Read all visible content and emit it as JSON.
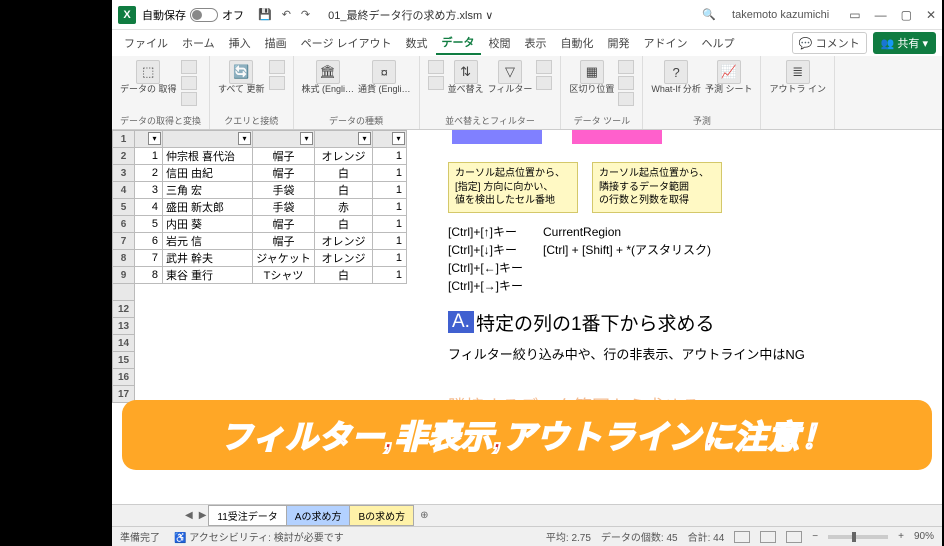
{
  "titlebar": {
    "autosave_label": "自動保存",
    "autosave_state": "オフ",
    "filename": "01_最終データ行の求め方.xlsm ∨",
    "search_icon": "🔍",
    "user": "takemoto kazumichi"
  },
  "menu": {
    "tabs": [
      "ファイル",
      "ホーム",
      "挿入",
      "描画",
      "ページ レイアウト",
      "数式",
      "データ",
      "校閲",
      "表示",
      "自動化",
      "開発",
      "アドイン",
      "ヘルプ"
    ],
    "active_index": 6,
    "comment": "コメント",
    "share": "共有"
  },
  "ribbon": {
    "g0": {
      "main": "データの\n取得",
      "label": "データの取得と変換"
    },
    "g1": {
      "main": "すべて\n更新",
      "label": "クエリと接続"
    },
    "g2": {
      "a": "株式 (Engli…",
      "b": "通貨 (Engli…",
      "label": "データの種類"
    },
    "g3": {
      "a": "並べ替え",
      "b": "フィルター",
      "label": "並べ替えとフィルター"
    },
    "g4": {
      "main": "区切り位置",
      "label": "データ ツール"
    },
    "g5": {
      "a": "What-If 分析",
      "b": "予測\nシート",
      "label": "予測"
    },
    "g6": {
      "main": "アウトラ\nイン"
    }
  },
  "table": {
    "rows": [
      {
        "n": "1",
        "name": "仲宗根 喜代治",
        "item": "帽子",
        "color": "オレンジ",
        "qty": "1"
      },
      {
        "n": "2",
        "name": "信田 由紀",
        "item": "帽子",
        "color": "白",
        "qty": "1"
      },
      {
        "n": "3",
        "name": "三角 宏",
        "item": "手袋",
        "color": "白",
        "qty": "1"
      },
      {
        "n": "4",
        "name": "盛田 新太郎",
        "item": "手袋",
        "color": "赤",
        "qty": "1"
      },
      {
        "n": "5",
        "name": "内田 葵",
        "item": "帽子",
        "color": "白",
        "qty": "1"
      },
      {
        "n": "6",
        "name": "岩元 信",
        "item": "帽子",
        "color": "オレンジ",
        "qty": "1"
      },
      {
        "n": "7",
        "name": "武井 幹夫",
        "item": "ジャケット",
        "color": "オレンジ",
        "qty": "1"
      },
      {
        "n": "8",
        "name": "東谷 重行",
        "item": "Tシャツ",
        "color": "白",
        "qty": "1"
      }
    ],
    "rownums_after": [
      "12",
      "13",
      "14",
      "15",
      "16",
      "17"
    ]
  },
  "notes": {
    "left": "カーソル起点位置から、\n[指定] 方向に向かい、\n値を検出したセル番地",
    "right": "カーソル起点位置から、\n隣接するデータ範囲\nの行数と列数を取得"
  },
  "keys": {
    "lines": [
      "[Ctrl]+[↑]キー",
      "[Ctrl]+[↓]キー",
      "[Ctrl]+[←]キー",
      "[Ctrl]+[→]キー"
    ],
    "right1": "CurrentRegion",
    "right2": "[Ctrl] + [Shift] + *(アスタリスク)"
  },
  "heading": {
    "badge": "A.",
    "text": "特定の列の1番下から求める"
  },
  "subtext": "フィルター絞り込み中や、行の非表示、アウトライン中はNG",
  "faded": "隣接するデータ範囲から求める",
  "banner": "フィルター,非表示,アウトラインに注意！",
  "sheets": [
    "11受注データ",
    "Aの求め方",
    "Bの求め方"
  ],
  "status": {
    "ready": "準備完了",
    "acc": "アクセシビリティ: 検討が必要です",
    "avg": "平均: 2.75",
    "count": "データの個数: 45",
    "sum": "合計: 44",
    "zoom": "90%"
  }
}
